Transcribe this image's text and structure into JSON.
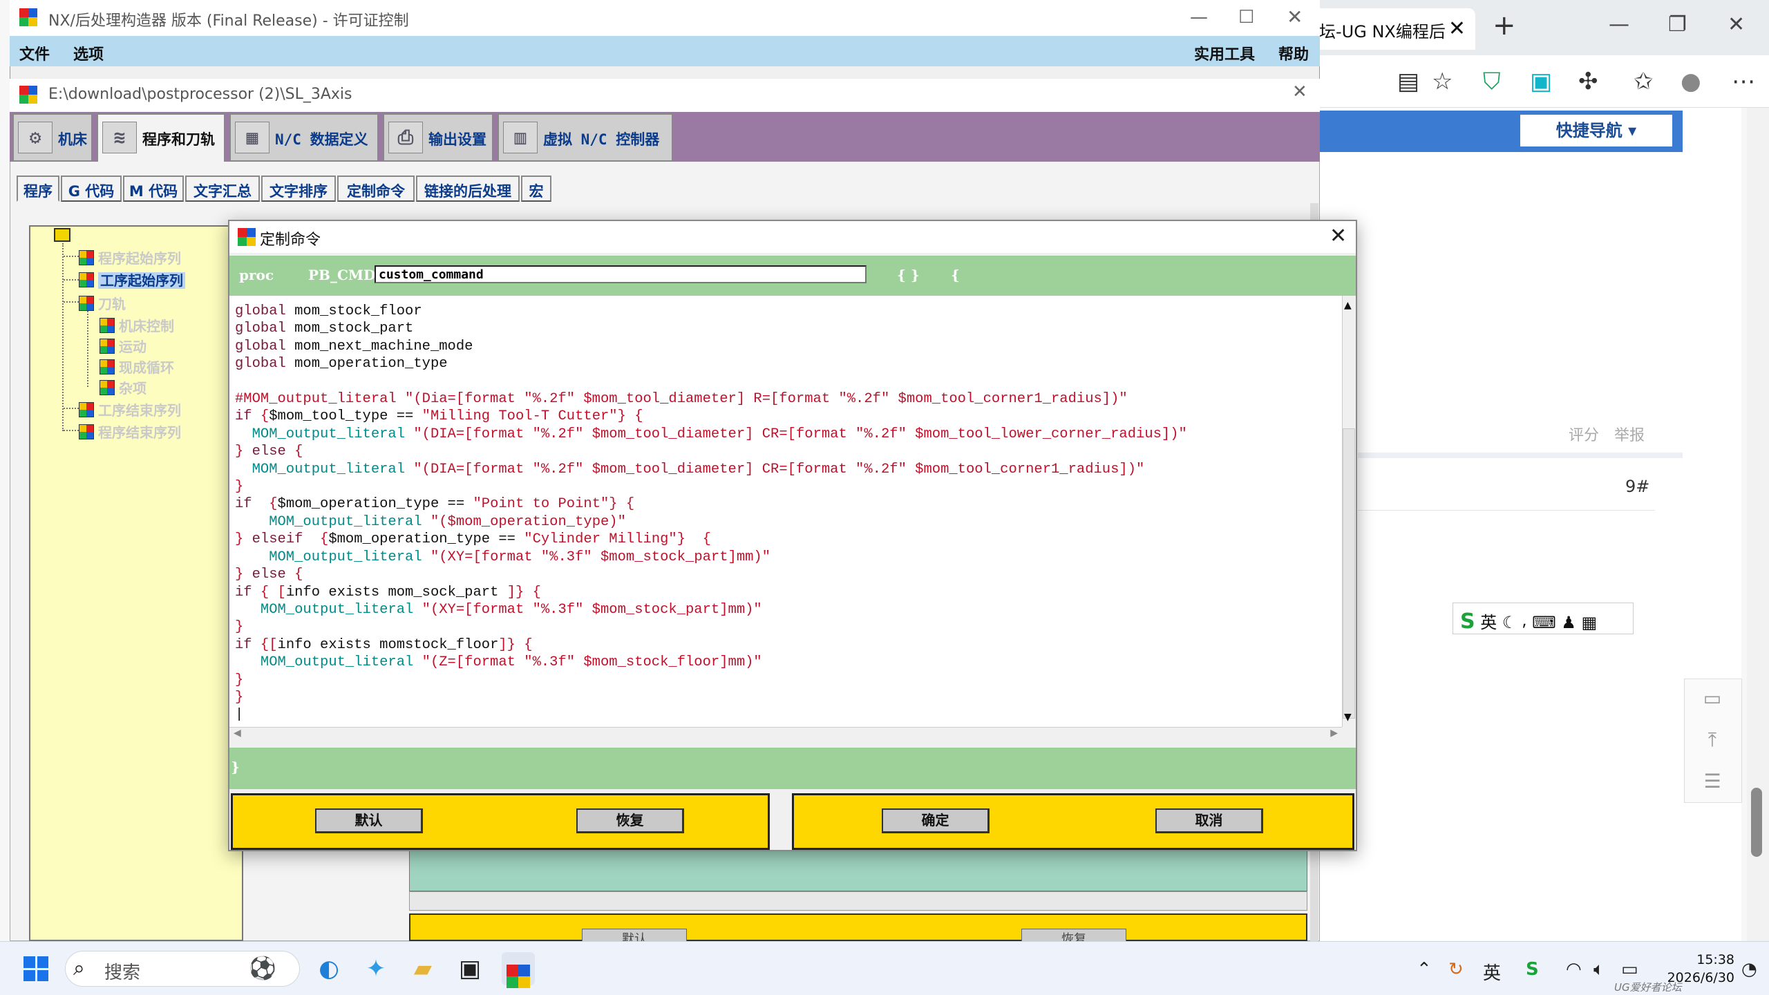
{
  "browser": {
    "tab_title": "坛-UG NX编程后",
    "tab_close": "✕",
    "new_tab": "+",
    "quick_nav": "快捷导航 ▾",
    "rate": "评分",
    "report": "举报",
    "floor": "9#",
    "ime_text": "英 ☾ ⸴ ⌨ ♟ ▦",
    "ime_logo": "S",
    "float_icons": [
      "comment-icon",
      "back-to-top-icon",
      "list-icon"
    ]
  },
  "nx": {
    "title": "NX/后处理构造器 版本 (Final Release) - 许可证控制",
    "menu": {
      "file": "文件",
      "options": "选项",
      "utilities": "实用工具",
      "help": "帮助"
    },
    "doc_path": "E:\\download\\postprocessor (2)\\SL_3Axis",
    "main_tabs": [
      {
        "label": "机床",
        "icon": "machine-icon"
      },
      {
        "label": "程序和刀轨",
        "icon": "program-icon"
      },
      {
        "label": "N/C 数据定义",
        "icon": "nc-data-icon"
      },
      {
        "label": "输出设置",
        "icon": "printer-icon"
      },
      {
        "label": "虚拟 N/C 控制器",
        "icon": "controller-icon"
      }
    ],
    "sub_tabs": [
      "程序",
      "G 代码",
      "M 代码",
      "文字汇总",
      "文字排序",
      "定制命令",
      "链接的后处理",
      "宏"
    ],
    "tree": [
      {
        "label": "程序起始序列",
        "selected": false
      },
      {
        "label": "工序起始序列",
        "selected": true
      },
      {
        "label": "刀轨",
        "selected": false
      },
      {
        "label": "机床控制",
        "selected": false
      },
      {
        "label": "运动",
        "selected": false
      },
      {
        "label": "现成循环",
        "selected": false
      },
      {
        "label": "杂项",
        "selected": false
      },
      {
        "label": "工序结束序列",
        "selected": false
      },
      {
        "label": "程序结束序列",
        "selected": false
      }
    ],
    "behind_buttons": {
      "default": "默认",
      "restore": "恢复"
    }
  },
  "dialog": {
    "title": "定制命令",
    "proc_keyword": "proc",
    "proc_prefix": "PB_CMD_",
    "proc_name": "custom_command",
    "proc_args": "{ }",
    "proc_open": "{",
    "end_brace": "}",
    "code_lines": [
      [
        [
          "kw",
          "global"
        ],
        [
          "vn",
          " mom_stock_floor"
        ]
      ],
      [
        [
          "kw",
          "global"
        ],
        [
          "vn",
          " mom_stock_part"
        ]
      ],
      [
        [
          "kw",
          "global"
        ],
        [
          "vn",
          " mom_next_machine_mode"
        ]
      ],
      [
        [
          "kw",
          "global"
        ],
        [
          "vn",
          " mom_operation_type"
        ]
      ],
      [
        [
          "vn",
          ""
        ]
      ],
      [
        [
          "cm",
          "#MOM_output_literal \"(Dia=[format \"%.2f\" $mom_tool_diameter] R=[format \"%.2f\" $mom_tool_corner1_radius])\""
        ]
      ],
      [
        [
          "kw",
          "if"
        ],
        [
          "cm",
          " {"
        ],
        [
          "vn",
          "$mom_tool_type =="
        ],
        [
          "cm",
          " \"Milling Tool-T Cutter\"} {"
        ]
      ],
      [
        [
          "cmd",
          "  MOM_output_literal"
        ],
        [
          "cm",
          " \"(DIA=[format \"%.2f\" $mom_tool_diameter] CR=[format \"%.2f\" $mom_tool_lower_corner_radius])\""
        ]
      ],
      [
        [
          "cm",
          "} "
        ],
        [
          "kw",
          "else"
        ],
        [
          "cm",
          " {"
        ]
      ],
      [
        [
          "cmd",
          "  MOM_output_literal"
        ],
        [
          "cm",
          " \"(DIA=[format \"%.2f\" $mom_tool_diameter] CR=[format \"%.2f\" $mom_tool_corner1_radius])\""
        ]
      ],
      [
        [
          "cm",
          "}"
        ]
      ],
      [
        [
          "kw",
          "if"
        ],
        [
          "cm",
          "  {"
        ],
        [
          "vn",
          "$mom_operation_type =="
        ],
        [
          "cm",
          " \"Point to Point\"} {"
        ]
      ],
      [
        [
          "cmd",
          "    MOM_output_literal"
        ],
        [
          "cm",
          " \"($mom_operation_type)\""
        ]
      ],
      [
        [
          "cm",
          "} "
        ],
        [
          "kw",
          "elseif"
        ],
        [
          "cm",
          "  {"
        ],
        [
          "vn",
          "$mom_operation_type =="
        ],
        [
          "cm",
          " \"Cylinder Milling\"}  {"
        ]
      ],
      [
        [
          "cmd",
          "    MOM_output_literal"
        ],
        [
          "cm",
          " \"(XY=[format \"%.3f\" $mom_stock_part]mm)\""
        ]
      ],
      [
        [
          "cm",
          "} "
        ],
        [
          "kw",
          "else"
        ],
        [
          "cm",
          " {"
        ]
      ],
      [
        [
          "kw",
          "if"
        ],
        [
          "cm",
          " { ["
        ],
        [
          "vn",
          "info exists mom_sock_part"
        ],
        [
          "cm",
          " ]} {"
        ]
      ],
      [
        [
          "cmd",
          "   MOM_output_literal"
        ],
        [
          "cm",
          " \"(XY=[format \"%.3f\" $mom_stock_part]mm)\""
        ]
      ],
      [
        [
          "cm",
          "}"
        ]
      ],
      [
        [
          "kw",
          "if"
        ],
        [
          "cm",
          " {["
        ],
        [
          "vn",
          "info exists momstock_floor"
        ],
        [
          "cm",
          "]} {"
        ]
      ],
      [
        [
          "cmd",
          "   MOM_output_literal"
        ],
        [
          "cm",
          " \"(Z=[format \"%.3f\" $mom_stock_floor]mm)\""
        ]
      ],
      [
        [
          "cm",
          "}"
        ]
      ],
      [
        [
          "cm",
          "}"
        ]
      ],
      [
        [
          "vn",
          "|"
        ]
      ]
    ],
    "buttons": {
      "default": "默认",
      "restore": "恢复",
      "ok": "确定",
      "cancel": "取消"
    }
  },
  "taskbar": {
    "search_placeholder": "搜索",
    "time": "15:38",
    "date": "2026/6/30",
    "watermark": "UG爱好者论坛 www.UGSNX.COM"
  }
}
